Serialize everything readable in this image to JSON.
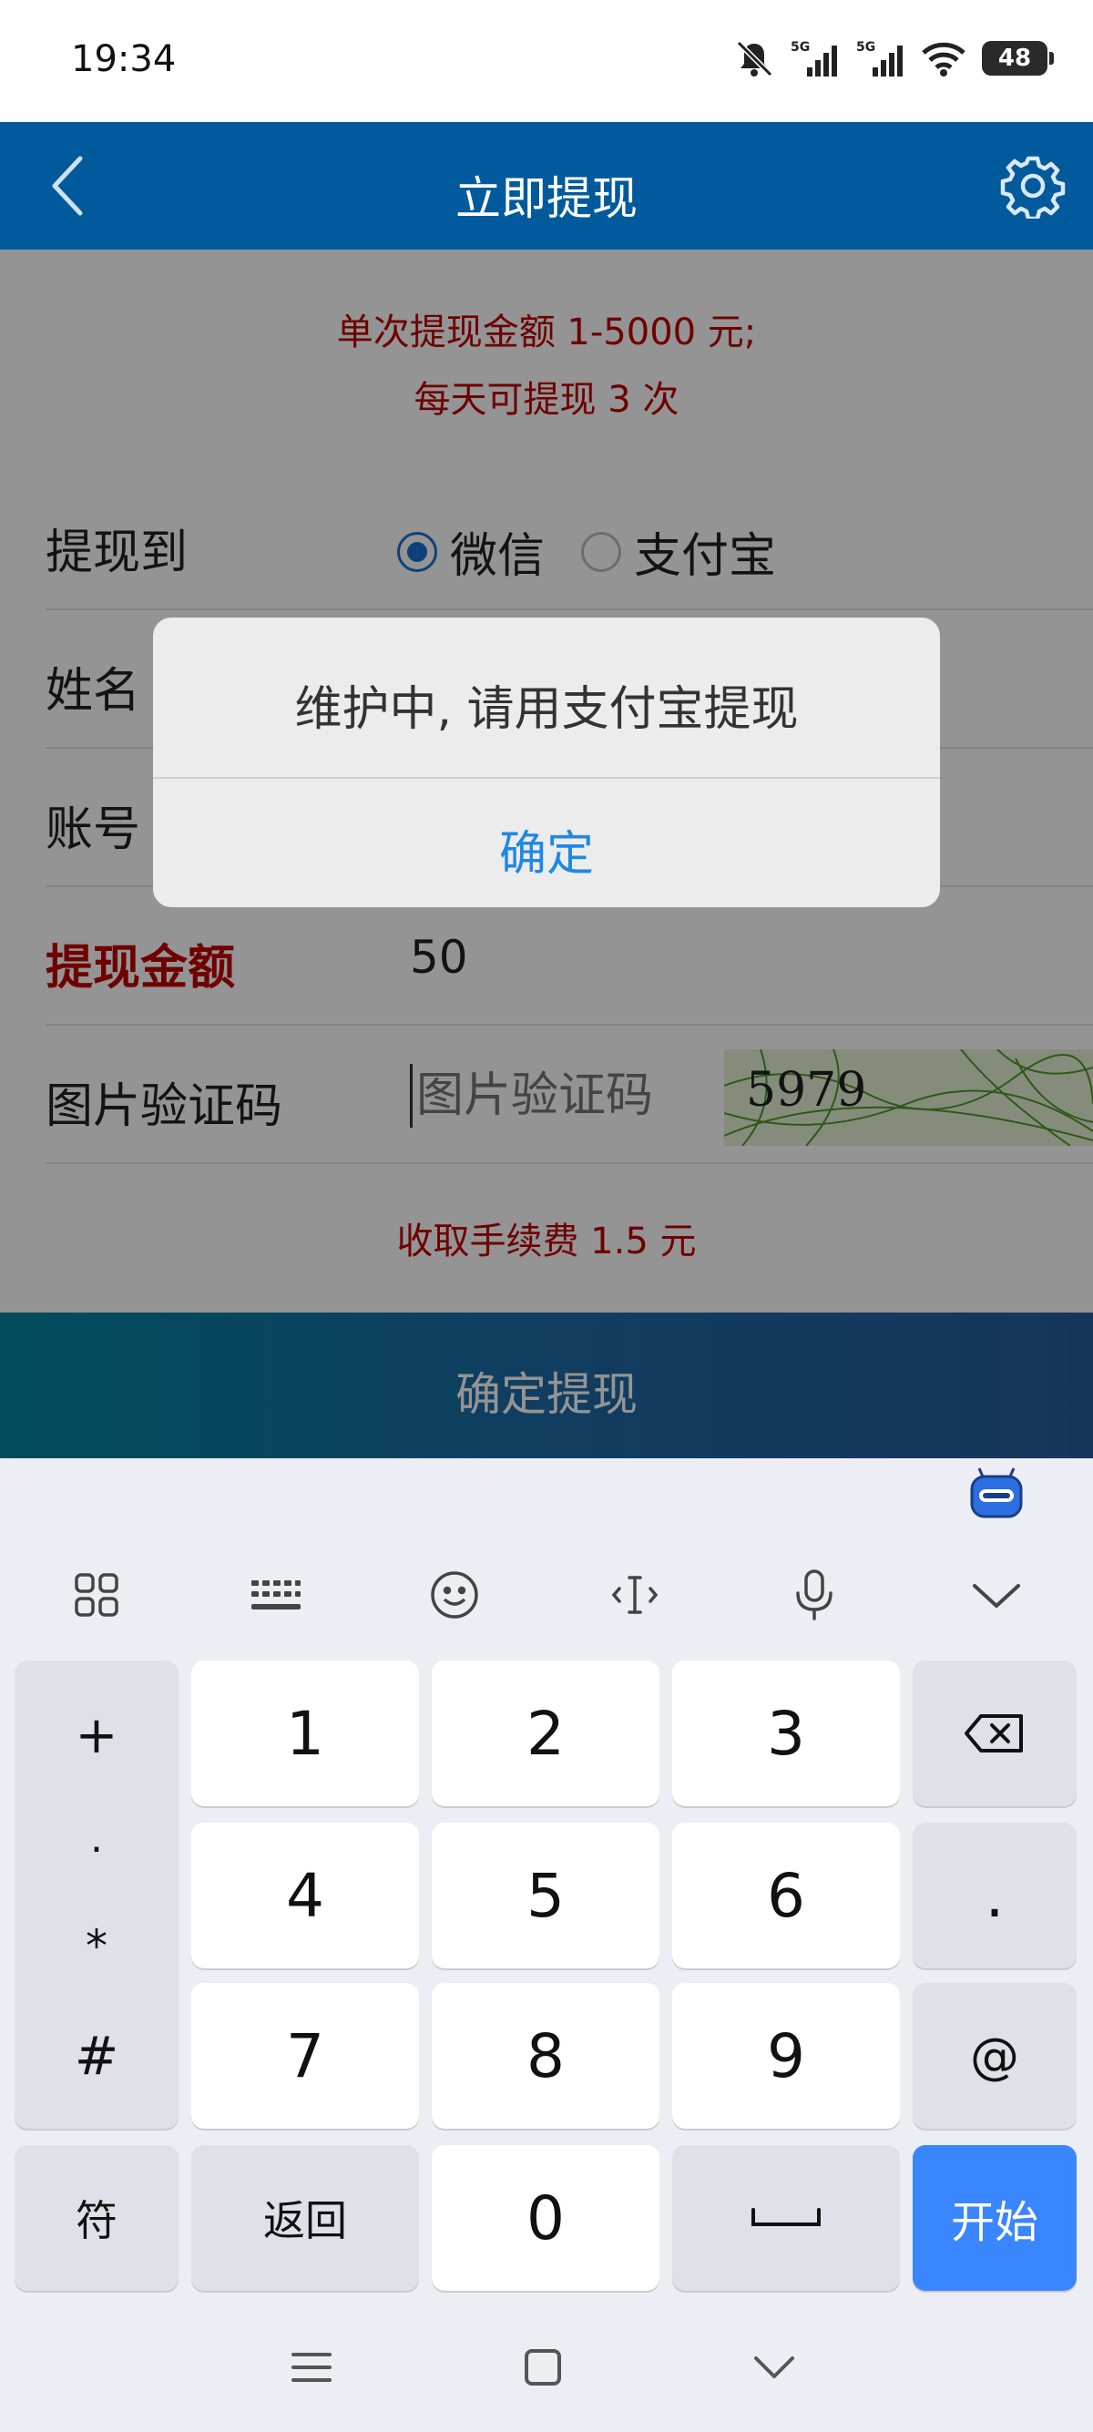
{
  "status_bar": {
    "time": "19:34",
    "battery": "48",
    "icons": [
      "mute-bell-icon",
      "signal-5g-icon",
      "signal-5g-icon",
      "wifi-icon",
      "battery-icon"
    ]
  },
  "header": {
    "title": "立即提现",
    "back_icon": "chevron-left-icon",
    "settings_icon": "gear-icon"
  },
  "notice": {
    "line1": "单次提现金额 1-5000 元;",
    "line2": "每天可提现 3 次"
  },
  "form": {
    "withdraw_to_label": "提现到",
    "option_wechat": "微信",
    "option_alipay": "支付宝",
    "selected": "微信",
    "name_label": "姓名",
    "account_label": "账号",
    "amount_label": "提现金额",
    "amount_value": "50",
    "captcha_label": "图片验证码",
    "captcha_placeholder": "图片验证码",
    "captcha_text": "5979"
  },
  "fee_text": "收取手续费 1.5 元",
  "submit_label": "确定提现",
  "dialog": {
    "message": "维护中, 请用支付宝提现",
    "ok_label": "确定"
  },
  "keyboard": {
    "symbols": [
      "+",
      ".",
      "*",
      "#"
    ],
    "digits": [
      "1",
      "2",
      "3",
      "4",
      "5",
      "6",
      "7",
      "8",
      "9",
      "0"
    ],
    "dot": ".",
    "at": "@",
    "symbol_key": "符",
    "back_key": "返回",
    "go_key": "开始",
    "toolbar_icons": [
      "apps-grid-icon",
      "keyboard-icon",
      "emoji-icon",
      "cursor-icon",
      "microphone-icon",
      "collapse-chevron-icon"
    ]
  },
  "colors": {
    "header_bg": "#005a9c",
    "notice_red": "#c00000",
    "dialog_button": "#1e88e5",
    "key_go": "#3a86ff"
  }
}
